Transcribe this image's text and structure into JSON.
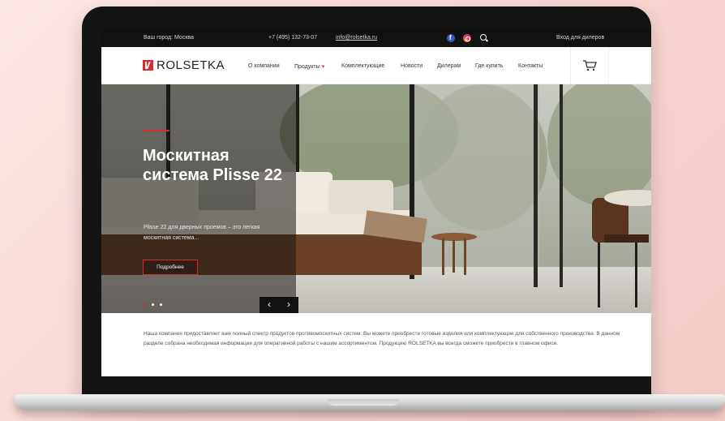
{
  "topbar": {
    "city": "Ваш город: Москва",
    "phone": "+7 (495) 132-73-07",
    "email": "info@rolsetka.ru",
    "dealer_login": "Вход для дилеров",
    "icons": [
      "facebook-icon",
      "instagram-icon",
      "search-icon"
    ]
  },
  "header": {
    "logo_text": "ROLSETKA",
    "nav": [
      {
        "label": "О компании"
      },
      {
        "label": "Продукты",
        "has_dropdown": true
      },
      {
        "label": "Комплектующие"
      },
      {
        "label": "Новости"
      },
      {
        "label": "Дилерам"
      },
      {
        "label": "Где купить"
      },
      {
        "label": "Контакты"
      }
    ],
    "cart_icon": "cart-icon"
  },
  "hero": {
    "title": "Москитная система Plisse 22",
    "description": "Plisse 22 для дверных проемов – это легкая москитная система...",
    "button_label": "Подробнее",
    "slides_total": 3,
    "active_slide": 1,
    "prev_arrow": "‹",
    "next_arrow": "›"
  },
  "about": {
    "text": "Наша компания предоставляет вам полный спектр продуктов противомоскитных систем. Вы можете приобрести готовые изделия или комплектующие для собственного производства. В данном разделе собрана необходимая информация для оперативной работы с нашим ассортиментом. Продукцию ROLSETKA вы всегда сможете приобрести в главном офисе."
  },
  "colors": {
    "accent": "#d92b2b",
    "topbar": "#111111",
    "background": "#f6d4d0"
  }
}
